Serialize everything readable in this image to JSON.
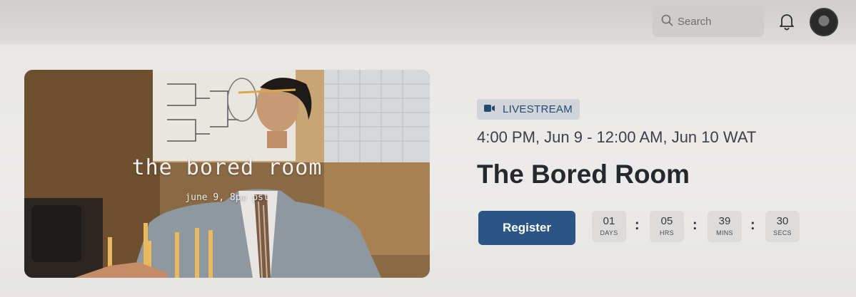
{
  "header": {
    "search_placeholder": "Search",
    "icons": [
      "search-icon",
      "bell-icon",
      "avatar"
    ]
  },
  "event": {
    "image_title": "the bored room",
    "image_subtitle": "june 9, 8pm pst",
    "badge_label": "LIVESTREAM",
    "badge_icon": "video-camera-icon",
    "datetime": "4:00 PM, Jun 9 - 12:00 AM, Jun 10 WAT",
    "title": "The Bored Room",
    "register_label": "Register"
  },
  "countdown": [
    {
      "value": "01",
      "label": "DAYS"
    },
    {
      "value": "05",
      "label": "HRS"
    },
    {
      "value": "39",
      "label": "MINS"
    },
    {
      "value": "30",
      "label": "SECS"
    }
  ],
  "colors": {
    "accent": "#2b5585",
    "badge_bg": "#d1d5d9",
    "badge_text": "#234a73"
  }
}
